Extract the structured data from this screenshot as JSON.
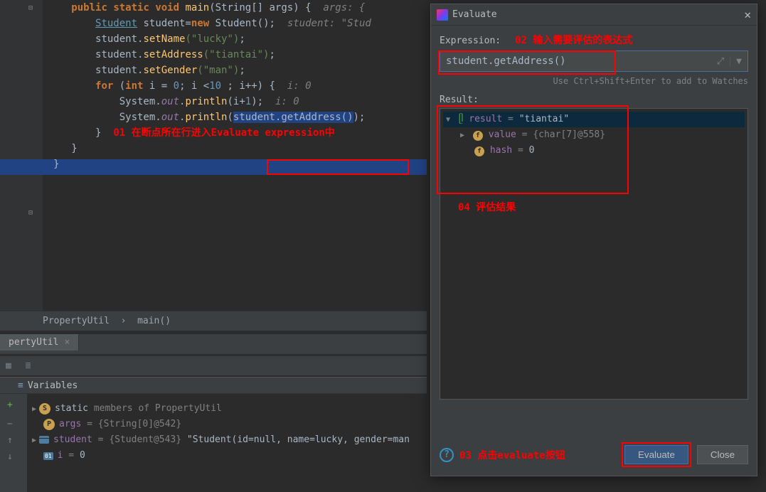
{
  "editor": {
    "l1": {
      "kw1": "public",
      "kw2": "static",
      "kw3": "void",
      "method": "main",
      "params": "(String[] args) {",
      "comment": "args: {"
    },
    "l2": {
      "type": "Student",
      "var": "student",
      "eq": "=",
      "kw": "new",
      "ctor": "Student()",
      "semi": ";",
      "comment": "student: \"Stud"
    },
    "l3": {
      "obj": "student.",
      "method": "setName",
      "arg": "(\"lucky\")",
      "semi": ";"
    },
    "l4": {
      "obj": "student.",
      "method": "setAddress",
      "arg": "(\"tiantai\")",
      "semi": ";"
    },
    "l5": {
      "obj": "student.",
      "method": "setGender",
      "arg": "(\"man\")",
      "semi": ";"
    },
    "l6": {
      "kw": "for",
      "open": " (",
      "kw2": "int",
      "init": " i = ",
      "z": "0",
      "cond": "; i <",
      "ten": "10",
      "inc": " ; i++) {",
      "comment": "i: 0"
    },
    "l7": {
      "cls": "System.",
      "out": "out",
      "dot": ".",
      "println": "println",
      "args": "(i+",
      "one": "1",
      "close": ");",
      "comment": "i: 0"
    },
    "l8": {
      "cls": "System.",
      "out": "out",
      "dot": ".",
      "println": "println",
      "open": "(",
      "expr": "student.getAddress()",
      "close": ");"
    },
    "l9": {
      "brace": "}"
    },
    "l10": {
      "brace": "}"
    },
    "l11": {
      "brace": "}"
    }
  },
  "annotations": {
    "a01": "01 在断点所在行进入Evaluate expression中",
    "a02": "02 输入需要评估的表达式",
    "a03": "03 点击evaluate按钮",
    "a04": "04 评估结果"
  },
  "breadcrumb": {
    "cls": "PropertyUtil",
    "sep": "›",
    "method": "main()"
  },
  "tabs": {
    "t1": "pertyUtil"
  },
  "variables": {
    "header": "Variables",
    "v1": {
      "name": "static",
      "suffix": "members of PropertyUtil"
    },
    "v2": {
      "name": "args",
      "eq": " = ",
      "val": "{String[0]@542}"
    },
    "v3": {
      "name": "student",
      "eq": " = ",
      "val": "{Student@543}",
      "str": " \"Student(id=null, name=lucky, gender=man"
    },
    "v4": {
      "name": "i",
      "eq": " = ",
      "val": "0"
    }
  },
  "dialog": {
    "title": "Evaluate",
    "exprLabel": "Expression:",
    "exprValue": "student.getAddress()",
    "hint": "Use Ctrl+Shift+Enter to add to Watches",
    "resultLabel": "Result:",
    "result": {
      "r1": {
        "name": "result",
        "eq": " = ",
        "val": "\"tiantai\""
      },
      "r2": {
        "name": "value",
        "eq": " = ",
        "val": "{char[7]@558}"
      },
      "r3": {
        "name": "hash",
        "eq": " = ",
        "val": "0"
      }
    },
    "evaluate": "Evaluate",
    "close": "Close"
  }
}
